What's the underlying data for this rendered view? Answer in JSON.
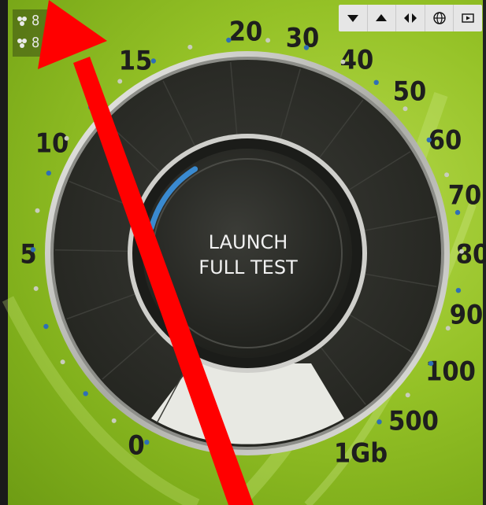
{
  "toolbar": {
    "buttons": [
      {
        "icon": "triangle-down-icon"
      },
      {
        "icon": "triangle-up-icon"
      },
      {
        "icon": "left-right-arrows-icon"
      },
      {
        "icon": "globe-icon"
      },
      {
        "icon": "film-icon"
      }
    ]
  },
  "stats": {
    "row1": {
      "icon": "connection-icon",
      "value": "8"
    },
    "row2": {
      "icon": "connection-icon",
      "value": "8"
    }
  },
  "gauge": {
    "center_label_line1": "LAUNCH",
    "center_label_line2": "FULL TEST",
    "scale_labels": [
      "0",
      "5",
      "10",
      "15",
      "20",
      "30",
      "40",
      "50",
      "60",
      "70",
      "80",
      "90",
      "100",
      "500",
      "1Gb"
    ],
    "progress_fraction": 0.12,
    "colors": {
      "accent": "#3a8ad0",
      "background": "#8fbf23",
      "dial": "#2a2b27",
      "arrow": "#ff0000"
    }
  },
  "annotation": {
    "type": "red-arrow"
  }
}
